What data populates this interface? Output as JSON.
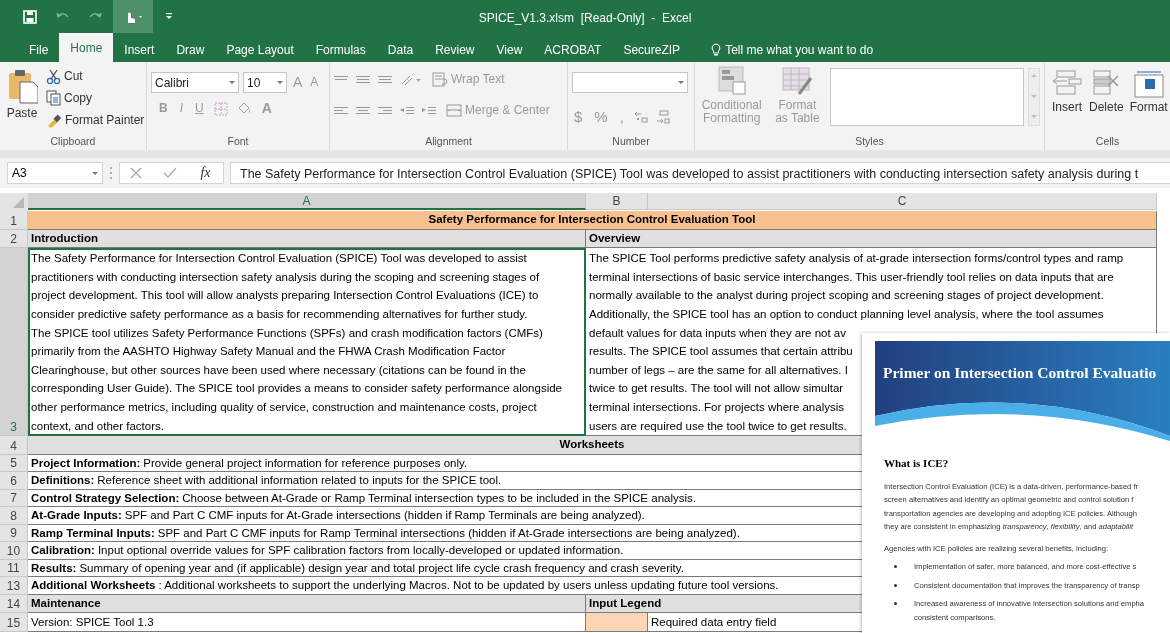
{
  "window": {
    "title": "SPICE_V1.3.xlsm  [Read-Only]  -  Excel"
  },
  "tabs": [
    {
      "label": "File",
      "selected": false
    },
    {
      "label": "Home",
      "selected": true
    },
    {
      "label": "Insert",
      "selected": false
    },
    {
      "label": "Draw",
      "selected": false
    },
    {
      "label": "Page Layout",
      "selected": false
    },
    {
      "label": "Formulas",
      "selected": false
    },
    {
      "label": "Data",
      "selected": false
    },
    {
      "label": "Review",
      "selected": false
    },
    {
      "label": "View",
      "selected": false
    },
    {
      "label": "ACROBAT",
      "selected": false
    },
    {
      "label": "SecureZIP",
      "selected": false
    }
  ],
  "tell_me": {
    "placeholder": "Tell me what you want to do"
  },
  "ribbon": {
    "clipboard": {
      "paste": "Paste",
      "cut": "Cut",
      "copy": "Copy",
      "format_painter": "Format Painter",
      "label": "Clipboard"
    },
    "font": {
      "name": "Calibri",
      "size": "10",
      "grow": "A",
      "shrink": "A",
      "bold": "B",
      "italic": "I",
      "underline": "U",
      "font_color": "A",
      "label": "Font"
    },
    "alignment": {
      "wrap_text": "Wrap Text",
      "merge_center": "Merge & Center",
      "label": "Alignment"
    },
    "number": {
      "currency": "$",
      "percent": "%",
      "comma": ",",
      "label": "Number"
    },
    "styles": {
      "conditional": "Conditional Formatting",
      "format_table": "Format as Table",
      "label": "Styles"
    },
    "cells": {
      "insert": "Insert",
      "delete": "Delete",
      "format": "Format",
      "label": "Cells"
    }
  },
  "formula_bar": {
    "name_box": "A3",
    "function_label": "fx",
    "formula": "The Safety Performance for Intersection Control Evaluation (SPICE) Tool was developed to assist practitioners with conducting intersection safety analysis during t"
  },
  "columns": [
    {
      "label": "A",
      "selected": true
    },
    {
      "label": "B",
      "selected": false
    },
    {
      "label": "C",
      "selected": false
    }
  ],
  "rows": [
    {
      "number": "1",
      "kind": "banner",
      "selected": false,
      "text": "Safety Performance for Intersection Control Evaluation Tool"
    },
    {
      "number": "2",
      "kind": "split",
      "selected": false,
      "cells": [
        "Introduction",
        "Overview"
      ]
    },
    {
      "number": "3",
      "kind": "paragraphs",
      "selected": true,
      "cells": [
        [
          "The Safety Performance for Intersection Control Evaluation (SPICE) Tool was developed to assist",
          "practitioners with conducting intersection safety analysis during the scoping and screening stages of",
          "project development. This tool will allow analysts preparing Intersection Control Evaluations (ICE) to",
          "consider predictive safety performance as a basis for recommending alternatives for further study.",
          "The SPICE tool utilizes Safety Performance Functions (SPFs) and crash modification factors (CMFs)",
          "primarily from the AASHTO Highway Safety Manual and the FHWA Crash Modification Factor",
          "Clearinghouse, but other sources have been used where necessary (citations can be found in the",
          "corresponding User Guide). The SPICE tool provides a means to consider safety performance alongside",
          "other performance metrics, including quality of service, construction and maintenance costs, project",
          "context, and other factors."
        ],
        [
          "The SPICE Tool performs predictive safety analysis of at-grade intersection forms/control types and ramp",
          "terminal intersections of basic service interchanges. This user-friendly tool relies on data inputs that are",
          "normally available to the analyst during project scoping and screening stages of project development.",
          "Additionally, the SPICE tool has an option to conduct planning level analysis, where the tool assumes",
          "default values for data inputs when they are not av",
          "results. The SPICE tool assumes that certain attribu",
          "number of legs – are the same for all alternatives. I",
          "twice to get results. The tool will not allow simultar",
          "terminal intersections. For projects where analysis",
          "users are required use the tool twice to get results."
        ]
      ]
    },
    {
      "number": "4",
      "kind": "section",
      "selected": false,
      "text": "Worksheets"
    },
    {
      "number": "5",
      "kind": "item",
      "selected": false,
      "text": "**Project Information:** Provide general project information for reference purposes only."
    },
    {
      "number": "6",
      "kind": "item",
      "selected": false,
      "text": "**Definitions:** Reference sheet with additional information related to inputs for the SPICE tool."
    },
    {
      "number": "7",
      "kind": "item",
      "selected": false,
      "text": "**Control Strategy Selection:** Choose between At-Grade or Ramp Terminal intersection types to be included in the SPICE analysis."
    },
    {
      "number": "8",
      "kind": "item",
      "selected": false,
      "text": "**At-Grade Inputs:** SPF and Part C CMF inputs for At-Grade intersections (hidden if Ramp Terminals are being analyzed)."
    },
    {
      "number": "9",
      "kind": "item",
      "selected": false,
      "text": "**Ramp Terminal Inputs:** SPF and Part C CMF inputs for Ramp Terminal intersections (hidden if At-Grade intersections are being analyzed)."
    },
    {
      "number": "10",
      "kind": "item",
      "selected": false,
      "text": "**Calibration:** Input optional override values for SPF calibration factors from locally-developed or updated information."
    },
    {
      "number": "11",
      "kind": "item",
      "selected": false,
      "text": "**Results:** Summary of opening year and (if applicable) design year and total project life cycle crash frequency and crash severity."
    },
    {
      "number": "13",
      "kind": "item",
      "selected": false,
      "text": "**Additional Worksheets**: Additional worksheets to support the underlying Macros. Not to be updated by users unless updating future tool versions."
    },
    {
      "number": "14",
      "kind": "split",
      "selected": false,
      "cells": [
        "Maintenance",
        "Input Legend"
      ]
    },
    {
      "number": "15",
      "kind": "legend",
      "selected": false,
      "text": "Version: SPICE Tool 1.3",
      "legend": "Required data entry field"
    }
  ],
  "document": {
    "title": "Primer on Intersection Control Evaluatio",
    "heading": "What is ICE?",
    "paragraph": [
      "Intersection Control Evaluation (ICE) is a data-driven, performance-based fr",
      "screen alternatives and identify an optimal geometric and control solution f",
      "transportation agencies are developing and adopting ICE policies. Although",
      "they are consistent in emphasizing *transparency*, *flexibility*, and *adaptabilit*"
    ],
    "intro": "Agencies with ICE policies are realizing several benefits, including:",
    "bullets": [
      [
        "Implementation of safer, more balanced, and more cost-effective s"
      ],
      [
        "Consistent documentation that improves the transparency of transp"
      ],
      [
        "Increased awareness of innovative intersection solutions and empha",
        "consistent comparisons."
      ]
    ]
  }
}
